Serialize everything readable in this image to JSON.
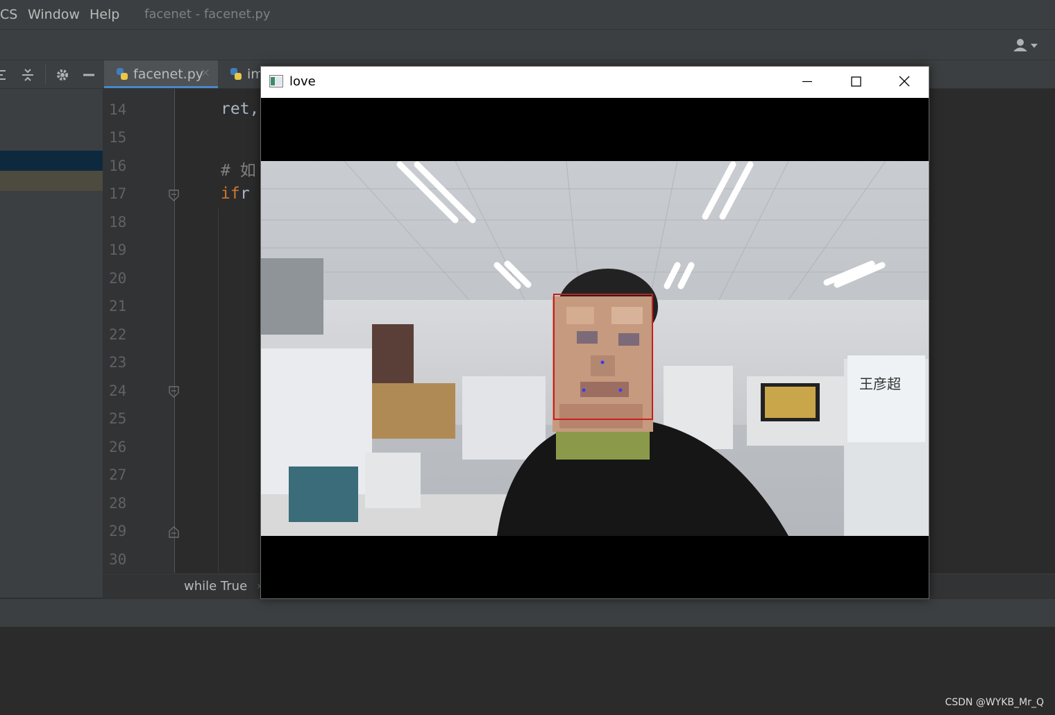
{
  "menu": {
    "items": [
      {
        "label": "CS"
      },
      {
        "label": "Window"
      },
      {
        "label": "Help"
      }
    ],
    "window_title": "facenet - facenet.py"
  },
  "tabs": [
    {
      "label": "facenet.py",
      "active": true
    },
    {
      "label": "im",
      "active": false
    }
  ],
  "editor": {
    "line_numbers": [
      "14",
      "15",
      "16",
      "17",
      "18",
      "19",
      "20",
      "21",
      "22",
      "23",
      "24",
      "25",
      "26",
      "27",
      "28",
      "29",
      "30"
    ],
    "code": {
      "line14": "ret,",
      "line16": "# 如",
      "line17_keyword": "if",
      "line17_rest": " r"
    }
  },
  "breadcrumb": {
    "label": "while True",
    "separator": "›"
  },
  "cv_window": {
    "title": "love",
    "buttons": [
      "minimize",
      "maximize",
      "close"
    ]
  },
  "watermark": "CSDN @WYKB_Mr_Q",
  "colors": {
    "keyword": "#cc7832",
    "code_text": "#a9b7c6",
    "comment": "#808080",
    "accent": "#4a88c7"
  }
}
